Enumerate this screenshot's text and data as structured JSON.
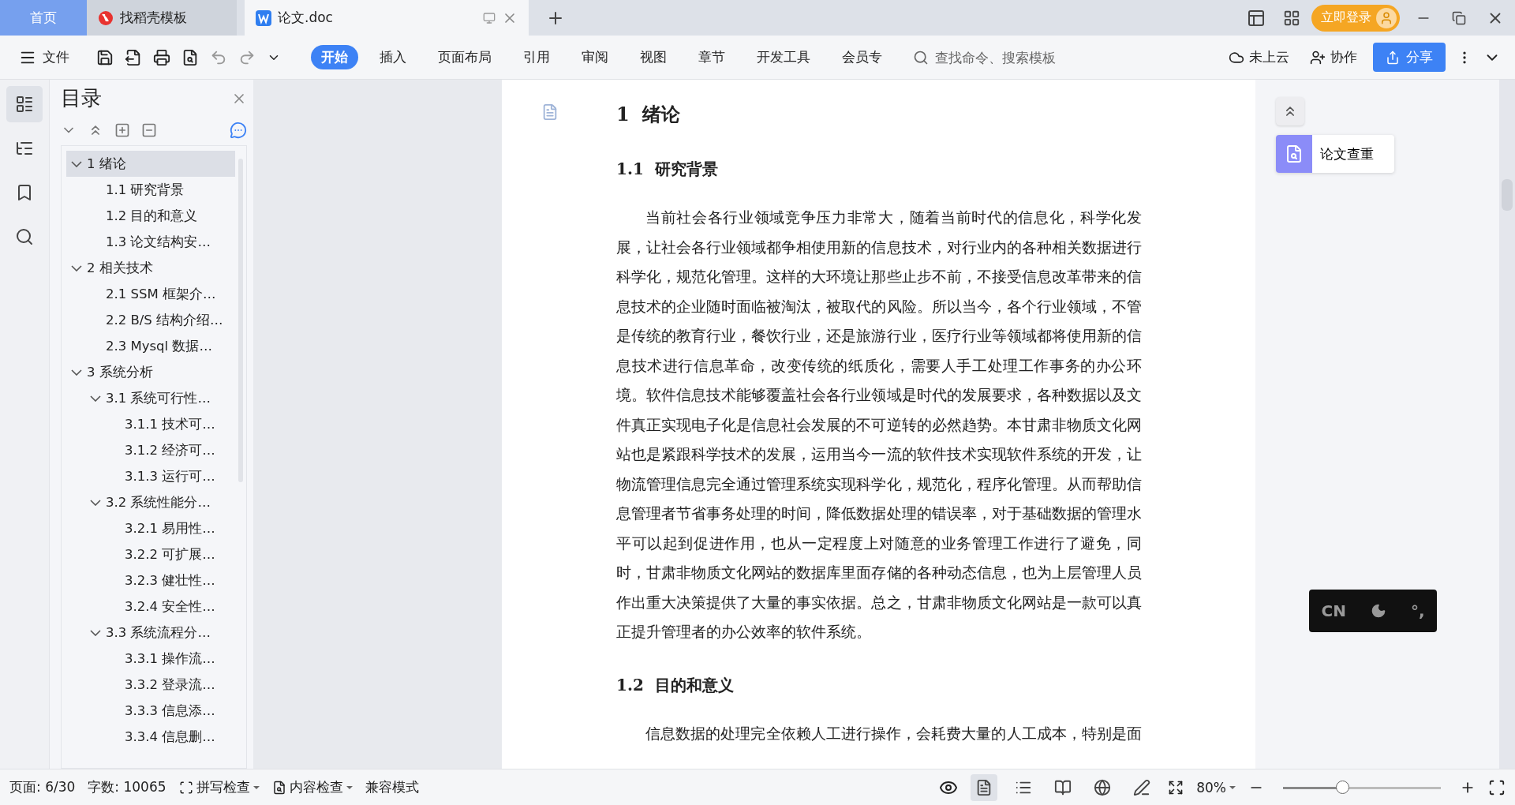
{
  "tabs": [
    {
      "label": "首页",
      "kind": "home",
      "selected": false
    },
    {
      "label": "找稻壳模板",
      "kind": "template",
      "selected": false
    },
    {
      "label": "论文.doc",
      "kind": "doc",
      "selected": true
    }
  ],
  "login": {
    "label": "立即登录"
  },
  "menu": {
    "label": "文件"
  },
  "ribbon_tabs": [
    {
      "label": "开始",
      "selected": true
    },
    {
      "label": "插入",
      "selected": false
    },
    {
      "label": "页面布局",
      "selected": false
    },
    {
      "label": "引用",
      "selected": false
    },
    {
      "label": "审阅",
      "selected": false
    },
    {
      "label": "视图",
      "selected": false
    },
    {
      "label": "章节",
      "selected": false
    },
    {
      "label": "开发工具",
      "selected": false
    },
    {
      "label": "会员专",
      "selected": false
    }
  ],
  "search": {
    "placeholder": "查找命令、搜索模板"
  },
  "cloud": {
    "label": "未上云"
  },
  "collab": {
    "label": "协作"
  },
  "share": {
    "label": "分享"
  },
  "rail": [
    {
      "kind": "outline",
      "selected": true
    },
    {
      "kind": "nav",
      "selected": false
    },
    {
      "kind": "bookmark",
      "selected": false
    },
    {
      "kind": "search",
      "selected": false
    }
  ],
  "outline": {
    "title": "目录",
    "items": [
      {
        "label": "1  绪论",
        "selected": true,
        "expanded": true,
        "children": [
          {
            "label": "1.1  研究背景",
            "selected": false
          },
          {
            "label": "1.2  目的和意义",
            "selected": false
          },
          {
            "label": "1.3  论文结构安…",
            "selected": false
          }
        ]
      },
      {
        "label": "2  相关技术",
        "selected": false,
        "expanded": true,
        "children": [
          {
            "label": "2.1 SSM 框架介…",
            "selected": false
          },
          {
            "label": "2.2 B/S 结构介绍…",
            "selected": false
          },
          {
            "label": "2.3 Mysql 数据…",
            "selected": false
          }
        ]
      },
      {
        "label": "3  系统分析",
        "selected": false,
        "expanded": true,
        "children": [
          {
            "label": "3.1  系统可行性…",
            "selected": false,
            "expanded": true,
            "children": [
              {
                "label": "3.1.1  技术可…",
                "selected": false
              },
              {
                "label": "3.1.2  经济可…",
                "selected": false
              },
              {
                "label": "3.1.3  运行可…",
                "selected": false
              }
            ]
          },
          {
            "label": "3.2  系统性能分…",
            "selected": false,
            "expanded": true,
            "children": [
              {
                "label": "3.2.1  易用性…",
                "selected": false
              },
              {
                "label": "3.2.2  可扩展…",
                "selected": false
              },
              {
                "label": "3.2.3  健壮性…",
                "selected": false
              },
              {
                "label": "3.2.4  安全性…",
                "selected": false
              }
            ]
          },
          {
            "label": "3.3  系统流程分…",
            "selected": false,
            "expanded": true,
            "children": [
              {
                "label": "3.3.1  操作流…",
                "selected": false
              },
              {
                "label": "3.3.2  登录流…",
                "selected": false
              },
              {
                "label": "3.3.3  信息添…",
                "selected": false
              },
              {
                "label": "3.3.4  信息删…",
                "selected": false
              }
            ]
          }
        ]
      }
    ]
  },
  "document": {
    "blocks": [
      {
        "kind": "h1",
        "number": "1",
        "text": "绪论"
      },
      {
        "kind": "h2",
        "number": "1.1",
        "text": "研究背景"
      },
      {
        "kind": "para",
        "text": "当前社会各行业领域竞争压力非常大，随着当前时代的信息化，科学化发展，让社会各行业领域都争相使用新的信息技术，对行业内的各种相关数据进行科学化，规范化管理。这样的大环境让那些止步不前，不接受信息改革带来的信息技术的企业随时面临被淘汰，被取代的风险。所以当今，各个行业领域，不管是传统的教育行业，餐饮行业，还是旅游行业，医疗行业等领域都将使用新的信息技术进行信息革命，改变传统的纸质化，需要人手工处理工作事务的办公环境。软件信息技术能够覆盖社会各行业领域是时代的发展要求，各种数据以及文件真正实现电子化是信息社会发展的不可逆转的必然趋势。本甘肃非物质文化网站也是紧跟科学技术的发展，运用当今一流的软件技术实现软件系统的开发，让物流管理信息完全通过管理系统实现科学化，规范化，程序化管理。从而帮助信息管理者节省事务处理的时间，降低数据处理的错误率，对于基础数据的管理水平可以起到促进作用，也从一定程度上对随意的业务管理工作进行了避免，同时，甘肃非物质文化网站的数据库里面存储的各种动态信息，也为上层管理人员作出重大决策提供了大量的事实依据。总之，甘肃非物质文化网站是一款可以真正提升管理者的办公效率的软件系统。"
      },
      {
        "kind": "h2",
        "number": "1.2",
        "text": "目的和意义"
      },
      {
        "kind": "para",
        "text": "信息数据的处理完全依赖人工进行操作，会耗费大量的人工成本，特别是面"
      }
    ]
  },
  "side": {
    "check_label": "论文查重"
  },
  "ime": {
    "lang": "CN",
    "punct": "°,"
  },
  "status": {
    "page": "页面: 6/30",
    "words": "字数: 10065",
    "spell": "拼写检查",
    "content": "内容检查",
    "mode": "兼容模式",
    "zoom": "80%"
  },
  "view_modes": [
    {
      "kind": "page",
      "selected": true
    },
    {
      "kind": "outline",
      "selected": false
    },
    {
      "kind": "read",
      "selected": false
    },
    {
      "kind": "web",
      "selected": false
    },
    {
      "kind": "pen",
      "selected": false
    }
  ],
  "zoom_slider": {
    "level": 0.38
  }
}
